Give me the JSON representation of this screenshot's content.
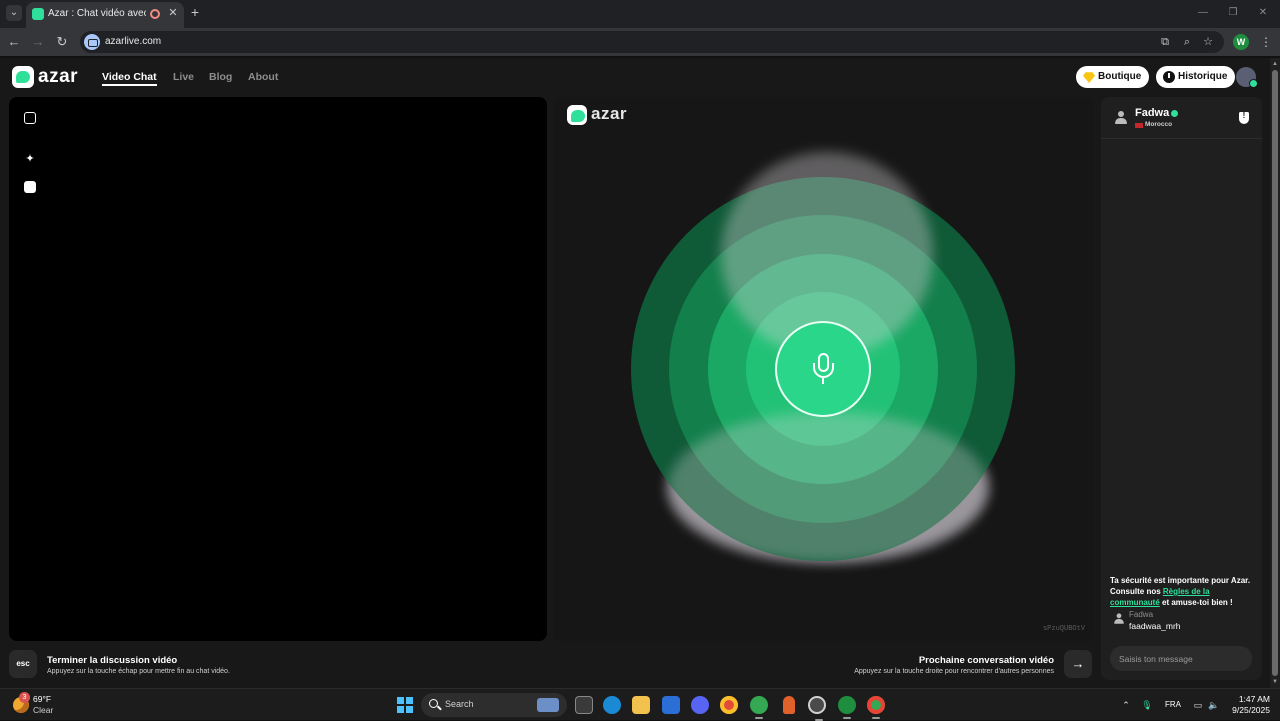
{
  "browser": {
    "tab_title": "Azar : Chat vidéo avec de n",
    "url": "azarlive.com"
  },
  "site": {
    "logo_text": "azar",
    "nav": {
      "video_chat": "Video Chat",
      "live": "Live",
      "blog": "Blog",
      "about": "About"
    },
    "boutique_label": "Boutique",
    "historique_label": "Historique",
    "peer_logo_text": "azar",
    "watermark": "sPzuQUBOtV",
    "chat": {
      "peer_name": "Fadwa",
      "peer_country": "Morocco",
      "safety_text_1": "Ta sécurité est importante pour Azar. Consulte nos ",
      "safety_link": "Règles de la communauté",
      "safety_text_2": " et amuse-toi bien !",
      "system_sender": "Fadwa",
      "system_message": "faadwaa_mrh",
      "input_placeholder": "Saisis ton message"
    },
    "hints": {
      "esc_key": "esc",
      "end_title": "Terminer la discussion vidéo",
      "end_desc": "Appuyez sur la touche échap pour mettre fin au chat vidéo.",
      "next_title": "Prochaine conversation vidéo",
      "next_desc": "Appuyez sur la touche droite pour rencontrer d'autres personnes",
      "next_key": "→"
    },
    "colors": {
      "accent": "#2fe09a",
      "ring_outer": "#0f5a37",
      "ring_mid": "#13804c",
      "ring_inner": "#1aa864"
    }
  },
  "taskbar": {
    "temperature": "69°F",
    "condition": "Clear",
    "weather_badge": "3",
    "search_label": "Search",
    "language": "FRA",
    "time": "1:47 AM",
    "date": "9/25/2025"
  }
}
